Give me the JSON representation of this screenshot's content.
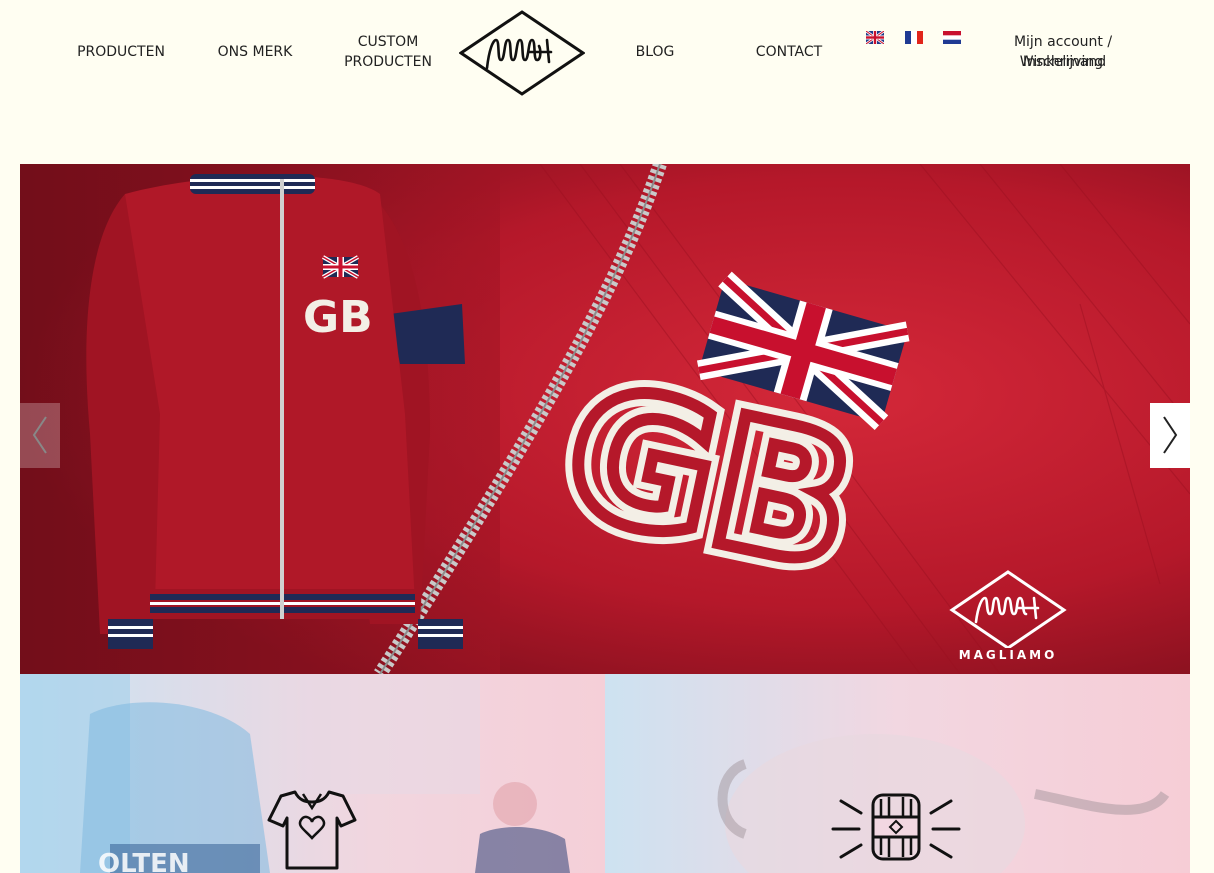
{
  "nav": {
    "producten": "PRODUCTEN",
    "ons_merk": "ONS MERK",
    "custom_line1": "CUSTOM",
    "custom_line2": "PRODUCTEN",
    "blog": "BLOG",
    "contact": "CONTACT"
  },
  "languages": [
    "en",
    "fr",
    "nl"
  ],
  "account": {
    "account_link": "Mijn account / Inschrijving",
    "cart_link": "Winkelmand"
  },
  "hero": {
    "jacket_text": "GB",
    "brand_name": "MAGLIAMO",
    "prev_icon": "chevron-left-icon",
    "next_icon": "chevron-right-icon"
  },
  "tiles": [
    {
      "icon": "jersey-heart-icon",
      "jersey_text": "OLTEN"
    },
    {
      "icon": "wool-yarn-icon"
    }
  ],
  "colors": {
    "background": "#fffef2",
    "hero_red": "#b3192a",
    "navy": "#1f2a55",
    "tile_blue": "#c9e3f3",
    "tile_pink": "#f5cfd8"
  }
}
